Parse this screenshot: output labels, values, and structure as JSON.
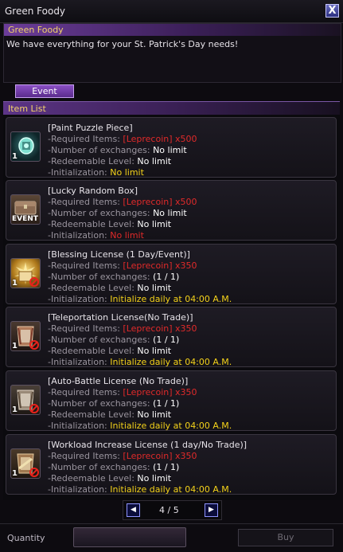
{
  "window": {
    "title": "Green Foody",
    "close_label": "X"
  },
  "npc": {
    "name": "Green Foody",
    "greeting": "We have everything for your St. Patrick's Day needs!"
  },
  "tabs": [
    {
      "label": "Event",
      "active": true
    }
  ],
  "item_list_label": "Item List",
  "field_labels": {
    "required": "-Required Items:",
    "exchanges": "-Number of exchanges:",
    "level": "-Redeemable Level:",
    "init": "-Initialization:"
  },
  "items": [
    {
      "name": "[Paint Puzzle Piece]",
      "required": "[Leprecoin] x500",
      "exchanges": "No limit",
      "level": "No limit",
      "init": "No limit",
      "icon": "puzzle-piece-icon",
      "count": "1",
      "no_trade": false
    },
    {
      "name": "[Lucky Random Box]",
      "required": "[Leprecoin] x500",
      "exchanges": "No limit",
      "level": "No limit",
      "init": "No limit",
      "icon": "event-chest-icon",
      "count": "",
      "icon_text": "EVENT",
      "no_trade": false
    },
    {
      "name": "[Blessing License (1 Day/Event)]",
      "required": "[Leprecoin] x350",
      "exchanges": "(1 / 1)",
      "level": "No limit",
      "init": "Initialize daily at 04:00 A.M.",
      "icon": "blessing-license-icon",
      "count": "1",
      "no_trade": true
    },
    {
      "name": "[Teleportation License(No Trade)]",
      "required": "[Leprecoin] x350",
      "exchanges": "(1 / 1)",
      "level": "No limit",
      "init": "Initialize daily at 04:00 A.M.",
      "icon": "license-scroll-icon",
      "count": "1",
      "no_trade": true
    },
    {
      "name": "[Auto-Battle License (No Trade)]",
      "required": "[Leprecoin] x350",
      "exchanges": "(1 / 1)",
      "level": "No limit",
      "init": "Initialize daily at 04:00 A.M.",
      "icon": "license-scroll-icon",
      "count": "1",
      "no_trade": true
    },
    {
      "name": "[Workload Increase License (1 day/No Trade)]",
      "required": "[Leprecoin] x350",
      "exchanges": "(1 / 1)",
      "level": "No limit",
      "init": "Initialize daily at 04:00 A.M.",
      "icon": "license-scroll-icon",
      "count": "1",
      "no_trade": true
    }
  ],
  "pager": {
    "text": "4 / 5",
    "prev_icon": "prev-arrow-icon",
    "next_icon": "next-arrow-icon"
  },
  "footer": {
    "quantity_label": "Quantity",
    "quantity_value": "",
    "buy_label": "Buy"
  },
  "colors": {
    "accent_purple": "#6c3d9a",
    "title_yellow": "#f3d36a",
    "required_red": "#e02a2a",
    "init_yellow": "#f4d21a"
  }
}
